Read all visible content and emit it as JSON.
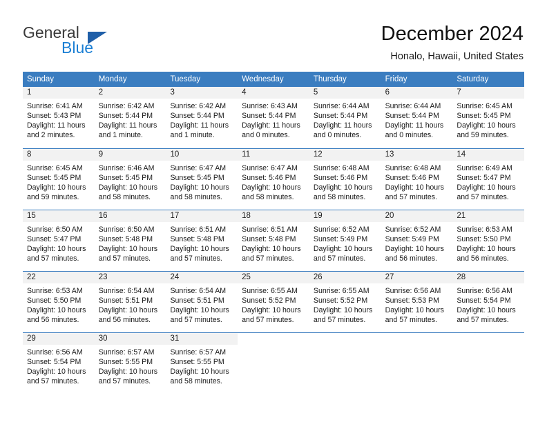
{
  "brand": {
    "name_part1": "General",
    "name_part2": "Blue",
    "triangle_color": "#1f5fa8",
    "blue_color": "#1b7fd4"
  },
  "header": {
    "title": "December 2024",
    "subtitle": "Honalo, Hawaii, United States"
  },
  "theme": {
    "header_bg": "#3b7dc0",
    "header_text": "#ffffff",
    "daynum_bg": "#f2f2f2",
    "row_separator": "#3b7dc0"
  },
  "weekdays": [
    "Sunday",
    "Monday",
    "Tuesday",
    "Wednesday",
    "Thursday",
    "Friday",
    "Saturday"
  ],
  "weeks": [
    [
      {
        "day": "1",
        "sunrise": "Sunrise: 6:41 AM",
        "sunset": "Sunset: 5:43 PM",
        "daylight1": "Daylight: 11 hours",
        "daylight2": "and 2 minutes."
      },
      {
        "day": "2",
        "sunrise": "Sunrise: 6:42 AM",
        "sunset": "Sunset: 5:44 PM",
        "daylight1": "Daylight: 11 hours",
        "daylight2": "and 1 minute."
      },
      {
        "day": "3",
        "sunrise": "Sunrise: 6:42 AM",
        "sunset": "Sunset: 5:44 PM",
        "daylight1": "Daylight: 11 hours",
        "daylight2": "and 1 minute."
      },
      {
        "day": "4",
        "sunrise": "Sunrise: 6:43 AM",
        "sunset": "Sunset: 5:44 PM",
        "daylight1": "Daylight: 11 hours",
        "daylight2": "and 0 minutes."
      },
      {
        "day": "5",
        "sunrise": "Sunrise: 6:44 AM",
        "sunset": "Sunset: 5:44 PM",
        "daylight1": "Daylight: 11 hours",
        "daylight2": "and 0 minutes."
      },
      {
        "day": "6",
        "sunrise": "Sunrise: 6:44 AM",
        "sunset": "Sunset: 5:44 PM",
        "daylight1": "Daylight: 11 hours",
        "daylight2": "and 0 minutes."
      },
      {
        "day": "7",
        "sunrise": "Sunrise: 6:45 AM",
        "sunset": "Sunset: 5:45 PM",
        "daylight1": "Daylight: 10 hours",
        "daylight2": "and 59 minutes."
      }
    ],
    [
      {
        "day": "8",
        "sunrise": "Sunrise: 6:45 AM",
        "sunset": "Sunset: 5:45 PM",
        "daylight1": "Daylight: 10 hours",
        "daylight2": "and 59 minutes."
      },
      {
        "day": "9",
        "sunrise": "Sunrise: 6:46 AM",
        "sunset": "Sunset: 5:45 PM",
        "daylight1": "Daylight: 10 hours",
        "daylight2": "and 58 minutes."
      },
      {
        "day": "10",
        "sunrise": "Sunrise: 6:47 AM",
        "sunset": "Sunset: 5:45 PM",
        "daylight1": "Daylight: 10 hours",
        "daylight2": "and 58 minutes."
      },
      {
        "day": "11",
        "sunrise": "Sunrise: 6:47 AM",
        "sunset": "Sunset: 5:46 PM",
        "daylight1": "Daylight: 10 hours",
        "daylight2": "and 58 minutes."
      },
      {
        "day": "12",
        "sunrise": "Sunrise: 6:48 AM",
        "sunset": "Sunset: 5:46 PM",
        "daylight1": "Daylight: 10 hours",
        "daylight2": "and 58 minutes."
      },
      {
        "day": "13",
        "sunrise": "Sunrise: 6:48 AM",
        "sunset": "Sunset: 5:46 PM",
        "daylight1": "Daylight: 10 hours",
        "daylight2": "and 57 minutes."
      },
      {
        "day": "14",
        "sunrise": "Sunrise: 6:49 AM",
        "sunset": "Sunset: 5:47 PM",
        "daylight1": "Daylight: 10 hours",
        "daylight2": "and 57 minutes."
      }
    ],
    [
      {
        "day": "15",
        "sunrise": "Sunrise: 6:50 AM",
        "sunset": "Sunset: 5:47 PM",
        "daylight1": "Daylight: 10 hours",
        "daylight2": "and 57 minutes."
      },
      {
        "day": "16",
        "sunrise": "Sunrise: 6:50 AM",
        "sunset": "Sunset: 5:48 PM",
        "daylight1": "Daylight: 10 hours",
        "daylight2": "and 57 minutes."
      },
      {
        "day": "17",
        "sunrise": "Sunrise: 6:51 AM",
        "sunset": "Sunset: 5:48 PM",
        "daylight1": "Daylight: 10 hours",
        "daylight2": "and 57 minutes."
      },
      {
        "day": "18",
        "sunrise": "Sunrise: 6:51 AM",
        "sunset": "Sunset: 5:48 PM",
        "daylight1": "Daylight: 10 hours",
        "daylight2": "and 57 minutes."
      },
      {
        "day": "19",
        "sunrise": "Sunrise: 6:52 AM",
        "sunset": "Sunset: 5:49 PM",
        "daylight1": "Daylight: 10 hours",
        "daylight2": "and 57 minutes."
      },
      {
        "day": "20",
        "sunrise": "Sunrise: 6:52 AM",
        "sunset": "Sunset: 5:49 PM",
        "daylight1": "Daylight: 10 hours",
        "daylight2": "and 56 minutes."
      },
      {
        "day": "21",
        "sunrise": "Sunrise: 6:53 AM",
        "sunset": "Sunset: 5:50 PM",
        "daylight1": "Daylight: 10 hours",
        "daylight2": "and 56 minutes."
      }
    ],
    [
      {
        "day": "22",
        "sunrise": "Sunrise: 6:53 AM",
        "sunset": "Sunset: 5:50 PM",
        "daylight1": "Daylight: 10 hours",
        "daylight2": "and 56 minutes."
      },
      {
        "day": "23",
        "sunrise": "Sunrise: 6:54 AM",
        "sunset": "Sunset: 5:51 PM",
        "daylight1": "Daylight: 10 hours",
        "daylight2": "and 56 minutes."
      },
      {
        "day": "24",
        "sunrise": "Sunrise: 6:54 AM",
        "sunset": "Sunset: 5:51 PM",
        "daylight1": "Daylight: 10 hours",
        "daylight2": "and 57 minutes."
      },
      {
        "day": "25",
        "sunrise": "Sunrise: 6:55 AM",
        "sunset": "Sunset: 5:52 PM",
        "daylight1": "Daylight: 10 hours",
        "daylight2": "and 57 minutes."
      },
      {
        "day": "26",
        "sunrise": "Sunrise: 6:55 AM",
        "sunset": "Sunset: 5:52 PM",
        "daylight1": "Daylight: 10 hours",
        "daylight2": "and 57 minutes."
      },
      {
        "day": "27",
        "sunrise": "Sunrise: 6:56 AM",
        "sunset": "Sunset: 5:53 PM",
        "daylight1": "Daylight: 10 hours",
        "daylight2": "and 57 minutes."
      },
      {
        "day": "28",
        "sunrise": "Sunrise: 6:56 AM",
        "sunset": "Sunset: 5:54 PM",
        "daylight1": "Daylight: 10 hours",
        "daylight2": "and 57 minutes."
      }
    ],
    [
      {
        "day": "29",
        "sunrise": "Sunrise: 6:56 AM",
        "sunset": "Sunset: 5:54 PM",
        "daylight1": "Daylight: 10 hours",
        "daylight2": "and 57 minutes."
      },
      {
        "day": "30",
        "sunrise": "Sunrise: 6:57 AM",
        "sunset": "Sunset: 5:55 PM",
        "daylight1": "Daylight: 10 hours",
        "daylight2": "and 57 minutes."
      },
      {
        "day": "31",
        "sunrise": "Sunrise: 6:57 AM",
        "sunset": "Sunset: 5:55 PM",
        "daylight1": "Daylight: 10 hours",
        "daylight2": "and 58 minutes."
      },
      {
        "day": "",
        "sunrise": "",
        "sunset": "",
        "daylight1": "",
        "daylight2": ""
      },
      {
        "day": "",
        "sunrise": "",
        "sunset": "",
        "daylight1": "",
        "daylight2": ""
      },
      {
        "day": "",
        "sunrise": "",
        "sunset": "",
        "daylight1": "",
        "daylight2": ""
      },
      {
        "day": "",
        "sunrise": "",
        "sunset": "",
        "daylight1": "",
        "daylight2": ""
      }
    ]
  ]
}
